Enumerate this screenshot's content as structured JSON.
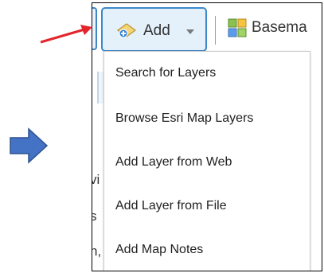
{
  "toolbar": {
    "add_label": "Add",
    "basemap_label": "Basema",
    "add_icon": "add-layer-icon",
    "chevron_icon": "chevron-down-icon",
    "basemap_icon": "basemap-grid-icon"
  },
  "background_fragments": [
    "vi",
    "s",
    "n,"
  ],
  "menu": {
    "items": [
      {
        "label": "Search for Layers"
      },
      {
        "label": "Browse Esri Map Layers"
      },
      {
        "label": "Add Layer from Web"
      },
      {
        "label": "Add Layer from File"
      },
      {
        "label": "Add Map Notes"
      }
    ]
  },
  "annotations": {
    "pointer_arrow_color": "#e3242b",
    "nav_arrow_color": "#4472c4"
  },
  "colors": {
    "accent_border": "#3c88c9",
    "button_fill": "#e4f0fa"
  }
}
